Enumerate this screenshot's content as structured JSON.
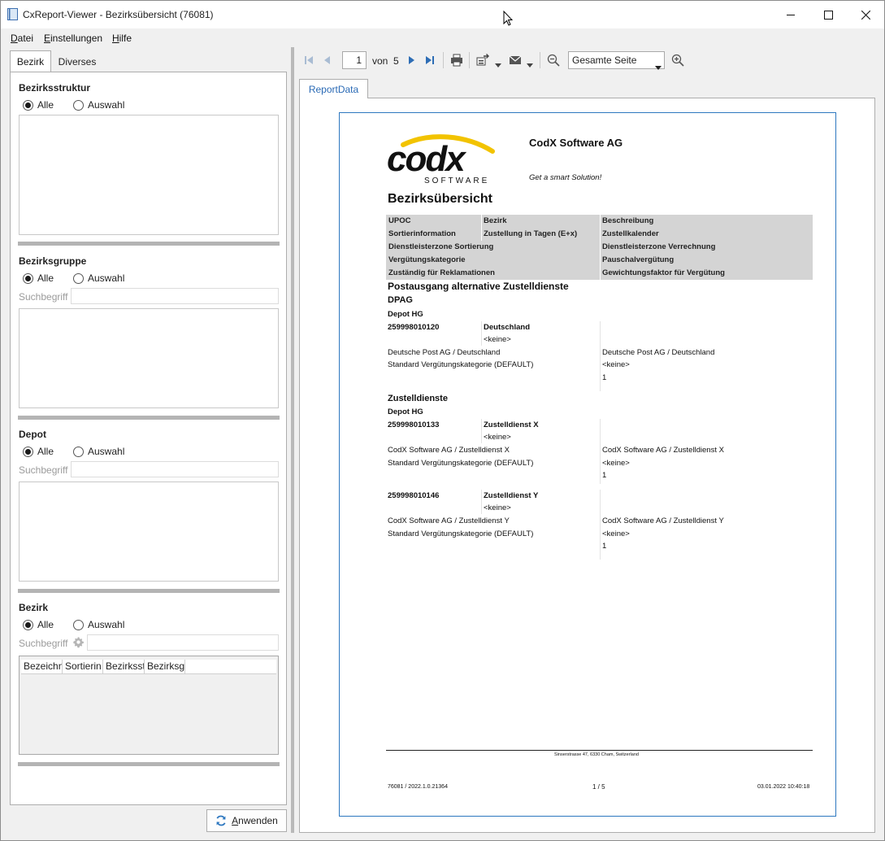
{
  "window": {
    "title": "CxReport-Viewer - Bezirksübersicht (76081)"
  },
  "menu": {
    "datei": "Datei",
    "einstellungen": "Einstellungen",
    "hilfe": "Hilfe"
  },
  "left_tabs": [
    "Bezirk",
    "Diverses"
  ],
  "filters": {
    "bezirksstruktur": {
      "title": "Bezirksstruktur",
      "all": "Alle",
      "selection": "Auswahl",
      "selected": "all"
    },
    "bezirksgruppe": {
      "title": "Bezirksgruppe",
      "all": "Alle",
      "selection": "Auswahl",
      "selected": "all",
      "search_label": "Suchbegriff",
      "search_value": ""
    },
    "depot": {
      "title": "Depot",
      "all": "Alle",
      "selection": "Auswahl",
      "selected": "all",
      "search_label": "Suchbegriff",
      "search_value": ""
    },
    "bezirk": {
      "title": "Bezirk",
      "all": "Alle",
      "selection": "Auswahl",
      "selected": "all",
      "search_label": "Suchbegriff",
      "search_value": "",
      "columns": [
        "Bezeichn",
        "Sortierin",
        "Bezirksst",
        "Bezirksgı"
      ]
    }
  },
  "apply_button": {
    "label_underlined": "A",
    "label_rest": "nwenden"
  },
  "toolbar": {
    "page": "1",
    "of_label": "von",
    "total_pages": "5",
    "zoom": "Gesamte Seite"
  },
  "report_tab": "ReportData",
  "report": {
    "company": "CodX Software AG",
    "tagline": "Get a smart Solution!",
    "logo_word": "codx",
    "logo_sub": "SOFTWARE",
    "title": "Bezirksübersicht",
    "header_rows": [
      [
        "UPOC",
        "Bezirk",
        "Beschreibung"
      ],
      [
        "Sortierinformation",
        "Zustellung in Tagen (E+x)",
        "Zustellkalender"
      ],
      [
        "Dienstleisterzone Sortierung",
        "",
        "Dienstleisterzone Verrechnung"
      ],
      [
        "Vergütungskategorie",
        "",
        "Pauschalvergütung"
      ],
      [
        "Zuständig für Reklamationen",
        "",
        "Gewichtungsfaktor für Vergütung"
      ]
    ],
    "section1": "Postausgang alternative Zustelldienste",
    "group1": "DPAG",
    "depot1": "Depot HG",
    "records": [
      {
        "upoc": "259998010120",
        "bezirk": "Deutschland",
        "sort": "<keine>",
        "zone_sort": "Deutsche Post AG / Deutschland",
        "zone_verr": "Deutsche Post AG / Deutschland",
        "kategorie": "Standard Vergütungskategorie (DEFAULT)",
        "pauschal": "<keine>",
        "faktor": "1"
      },
      {
        "upoc": "259998010133",
        "bezirk": "Zustelldienst X",
        "sort": "<keine>",
        "zone_sort": "CodX Software AG / Zustelldienst X",
        "zone_verr": "CodX Software AG / Zustelldienst X",
        "kategorie": "Standard Vergütungskategorie (DEFAULT)",
        "pauschal": "<keine>",
        "faktor": "1"
      },
      {
        "upoc": "259998010146",
        "bezirk": "Zustelldienst Y",
        "sort": "<keine>",
        "zone_sort": "CodX Software AG / Zustelldienst Y",
        "zone_verr": "CodX Software AG / Zustelldienst Y",
        "kategorie": "Standard Vergütungskategorie (DEFAULT)",
        "pauschal": "<keine>",
        "faktor": "1"
      }
    ],
    "group2": "Zustelldienste",
    "depot2": "Depot HG",
    "address": "Sinserstrasse 47, 6330 Cham, Switzerland",
    "footer_left": "76081 / 2022.1.0.21364",
    "footer_center": "1 / 5",
    "footer_right": "03.01.2022 10:40:18"
  },
  "colors": {
    "accent": "#2d77bf",
    "logo_yellow": "#f2c300",
    "header_gray": "#d4d4d4"
  }
}
